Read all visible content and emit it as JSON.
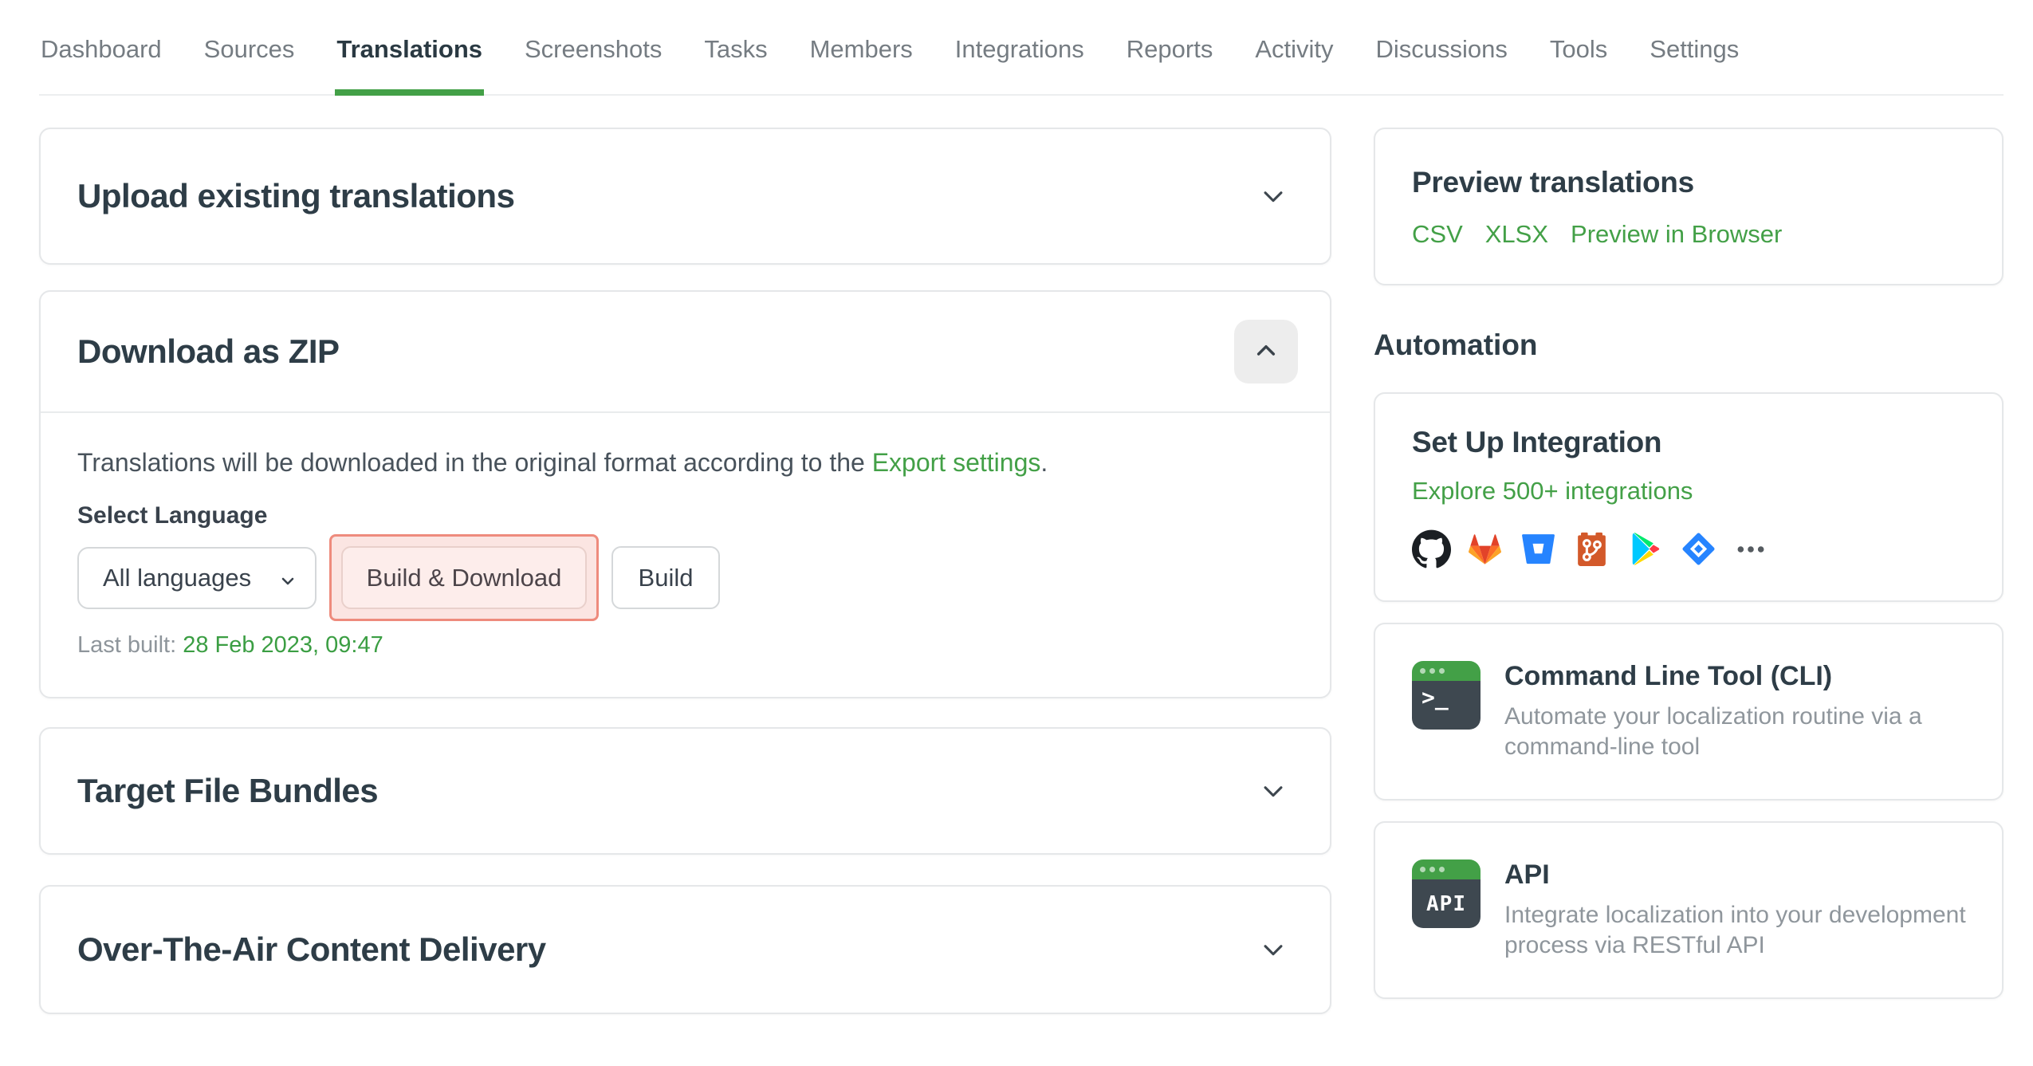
{
  "colors": {
    "accent_green": "#43a047",
    "date_green": "#3b9e43",
    "highlight_pink_border": "#ee8b7d",
    "highlight_pink_fill": "#fbe5e2",
    "title_dark": "#2e3d47"
  },
  "nav": {
    "items": [
      {
        "label": "Dashboard",
        "active": false
      },
      {
        "label": "Sources",
        "active": false
      },
      {
        "label": "Translations",
        "active": true
      },
      {
        "label": "Screenshots",
        "active": false
      },
      {
        "label": "Tasks",
        "active": false
      },
      {
        "label": "Members",
        "active": false
      },
      {
        "label": "Integrations",
        "active": false
      },
      {
        "label": "Reports",
        "active": false
      },
      {
        "label": "Activity",
        "active": false
      },
      {
        "label": "Discussions",
        "active": false
      },
      {
        "label": "Tools",
        "active": false
      },
      {
        "label": "Settings",
        "active": false
      }
    ]
  },
  "main": {
    "upload_card": {
      "title": "Upload existing translations"
    },
    "download_card": {
      "title": "Download as ZIP",
      "description_prefix": "Translations will be downloaded in the original format according to the ",
      "description_link": "Export settings",
      "description_suffix": ".",
      "select_label": "Select Language",
      "language_value": "All languages",
      "build_download_label": "Build & Download",
      "build_label": "Build",
      "last_built_label": "Last built: ",
      "last_built_value": "28 Feb 2023, 09:47"
    },
    "bundles_card": {
      "title": "Target File Bundles"
    },
    "ota_card": {
      "title": "Over-The-Air Content Delivery"
    }
  },
  "sidebar": {
    "preview": {
      "title": "Preview translations",
      "links": [
        {
          "label": "CSV"
        },
        {
          "label": "XLSX"
        },
        {
          "label": "Preview in Browser"
        }
      ]
    },
    "automation_heading": "Automation",
    "integration": {
      "title": "Set Up Integration",
      "link": "Explore 500+ integrations",
      "icons": [
        "github",
        "gitlab",
        "bitbucket",
        "git",
        "google-play",
        "jira",
        "more"
      ]
    },
    "cli": {
      "title": "Command Line Tool (CLI)",
      "icon_text": ">_",
      "description_line1": "Automate your localization routine via a",
      "description_line2": "command-line tool"
    },
    "api": {
      "title": "API",
      "icon_text": "API",
      "description_line1": "Integrate localization into your development",
      "description_line2": "process via RESTful API"
    }
  }
}
